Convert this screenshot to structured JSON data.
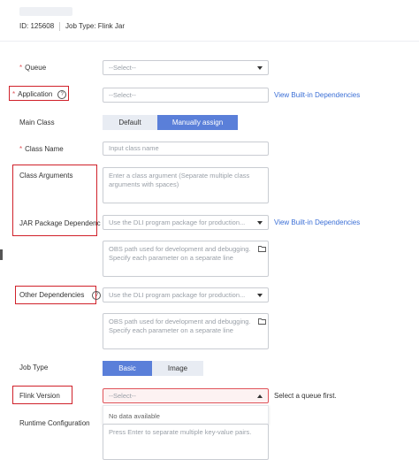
{
  "header": {
    "id_text": "ID: 125608",
    "job_type_text": "Job Type: Flink Jar"
  },
  "form": {
    "queue": {
      "required": "*",
      "label": "Queue",
      "placeholder": "--Select--"
    },
    "application": {
      "required": "*",
      "label": "Application",
      "placeholder": "--Select--",
      "link": "View Built-in Dependencies"
    },
    "main_class": {
      "label": "Main Class",
      "options": [
        "Default",
        "Manually assign"
      ],
      "selected": "Manually assign"
    },
    "class_name": {
      "required": "*",
      "label": "Class Name",
      "placeholder": "Input class name"
    },
    "class_arguments": {
      "label": "Class Arguments",
      "placeholder": "Enter a class argument (Separate multiple class arguments with spaces)"
    },
    "jar_package": {
      "label": "JAR Package Dependenc",
      "placeholder": "Use the DLI program package for production...",
      "link": "View Built-in Dependencies",
      "obs_placeholder": "OBS path used for development and debugging. Specify each parameter on a separate line"
    },
    "other_dependencies": {
      "label": "Other Dependencies",
      "placeholder": "Use the DLI program package for production...",
      "obs_placeholder": "OBS path used for development and debugging. Specify each parameter on a separate line"
    },
    "job_type": {
      "label": "Job Type",
      "options": [
        "Basic",
        "Image"
      ],
      "selected": "Basic"
    },
    "flink_version": {
      "label": "Flink Version",
      "placeholder": "--Select--",
      "hint": "Select a queue first.",
      "dropdown_empty": "No data available"
    },
    "runtime_configuration": {
      "label": "Runtime Configuration",
      "placeholder": "Press Enter to separate multiple key-value pairs."
    }
  },
  "colors": {
    "accent": "#5a7fd9",
    "link": "#3b6fd6",
    "error": "#d0212a",
    "required": "#e0545a"
  }
}
